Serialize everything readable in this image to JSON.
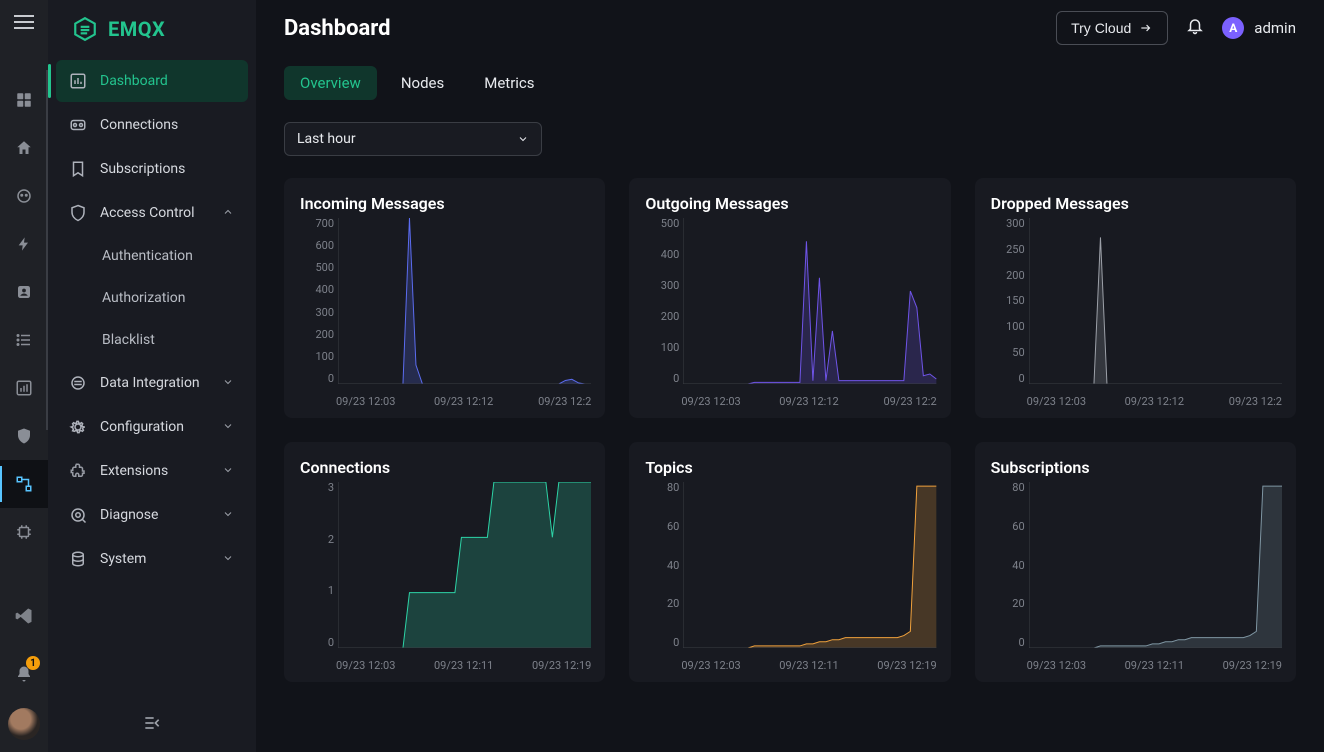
{
  "app": {
    "brand": "EMQX"
  },
  "header": {
    "title": "Dashboard",
    "try_cloud": "Try Cloud",
    "user_name": "admin",
    "user_initial": "A"
  },
  "sidebar": {
    "items": [
      {
        "id": "dashboard",
        "label": "Dashboard",
        "icon": "chart-icon",
        "active": true,
        "expandable": false
      },
      {
        "id": "connections",
        "label": "Connections",
        "icon": "link-icon",
        "active": false,
        "expandable": false
      },
      {
        "id": "subscriptions",
        "label": "Subscriptions",
        "icon": "bookmark-icon",
        "active": false,
        "expandable": false
      },
      {
        "id": "accesscontrol",
        "label": "Access Control",
        "icon": "shield-icon",
        "active": false,
        "expandable": true,
        "expanded": true,
        "children": [
          {
            "id": "authn",
            "label": "Authentication"
          },
          {
            "id": "authz",
            "label": "Authorization"
          },
          {
            "id": "blacklist",
            "label": "Blacklist"
          }
        ]
      },
      {
        "id": "dataint",
        "label": "Data Integration",
        "icon": "integ-icon",
        "active": false,
        "expandable": true
      },
      {
        "id": "config",
        "label": "Configuration",
        "icon": "gear-icon",
        "active": false,
        "expandable": true
      },
      {
        "id": "ext",
        "label": "Extensions",
        "icon": "puzzle-icon",
        "active": false,
        "expandable": true
      },
      {
        "id": "diag",
        "label": "Diagnose",
        "icon": "eye-icon",
        "active": false,
        "expandable": true
      },
      {
        "id": "system",
        "label": "System",
        "icon": "db-icon",
        "active": false,
        "expandable": true
      }
    ]
  },
  "tabs": {
    "items": [
      {
        "id": "overview",
        "label": "Overview",
        "active": true
      },
      {
        "id": "nodes",
        "label": "Nodes",
        "active": false
      },
      {
        "id": "metrics",
        "label": "Metrics",
        "active": false
      }
    ]
  },
  "time_range": {
    "selected": "Last hour"
  },
  "chart_data": [
    {
      "id": "incoming",
      "title": "Incoming Messages",
      "type": "area",
      "color": "#5b6cf0",
      "y_ticks": [
        "700",
        "600",
        "500",
        "400",
        "300",
        "200",
        "100",
        "0"
      ],
      "ylim": [
        0,
        700
      ],
      "x_ticks": [
        "09/23 12:03",
        "09/23 12:12",
        "09/23 12:2"
      ],
      "x": [
        0,
        1,
        2,
        3,
        4,
        5,
        6,
        7,
        8,
        9,
        10,
        11,
        12,
        13,
        14,
        15,
        16,
        17,
        18,
        19,
        20,
        21,
        22,
        23,
        24,
        25,
        26,
        27,
        28,
        29,
        30,
        31,
        32,
        33,
        34,
        35,
        36,
        37,
        38,
        39
      ],
      "values": [
        0,
        0,
        0,
        0,
        0,
        0,
        0,
        0,
        0,
        0,
        0,
        700,
        80,
        0,
        0,
        0,
        0,
        0,
        0,
        0,
        0,
        0,
        0,
        0,
        0,
        0,
        0,
        0,
        0,
        0,
        0,
        0,
        0,
        0,
        0,
        15,
        20,
        5,
        0,
        0
      ]
    },
    {
      "id": "outgoing",
      "title": "Outgoing Messages",
      "type": "area",
      "color": "#6f54e8",
      "y_ticks": [
        "500",
        "400",
        "300",
        "200",
        "100",
        "0"
      ],
      "ylim": [
        0,
        500
      ],
      "x_ticks": [
        "09/23 12:03",
        "09/23 12:12",
        "09/23 12:2"
      ],
      "x": [
        0,
        1,
        2,
        3,
        4,
        5,
        6,
        7,
        8,
        9,
        10,
        11,
        12,
        13,
        14,
        15,
        16,
        17,
        18,
        19,
        20,
        21,
        22,
        23,
        24,
        25,
        26,
        27,
        28,
        29,
        30,
        31,
        32,
        33,
        34,
        35,
        36,
        37,
        38,
        39
      ],
      "values": [
        0,
        0,
        0,
        0,
        0,
        0,
        0,
        0,
        0,
        0,
        0,
        5,
        5,
        5,
        5,
        5,
        5,
        5,
        5,
        430,
        10,
        320,
        10,
        160,
        10,
        10,
        10,
        10,
        10,
        10,
        10,
        10,
        10,
        10,
        10,
        280,
        230,
        25,
        30,
        15
      ]
    },
    {
      "id": "dropped",
      "title": "Dropped Messages",
      "type": "area",
      "color": "#9ca0a8",
      "y_ticks": [
        "300",
        "250",
        "200",
        "150",
        "100",
        "50",
        "0"
      ],
      "ylim": [
        0,
        300
      ],
      "x_ticks": [
        "09/23 12:03",
        "09/23 12:12",
        "09/23 12:2"
      ],
      "x": [
        0,
        1,
        2,
        3,
        4,
        5,
        6,
        7,
        8,
        9,
        10,
        11,
        12,
        13,
        14,
        15,
        16,
        17,
        18,
        19,
        20,
        21,
        22,
        23,
        24,
        25,
        26,
        27,
        28,
        29,
        30,
        31,
        32,
        33,
        34,
        35,
        36,
        37,
        38,
        39
      ],
      "values": [
        0,
        0,
        0,
        0,
        0,
        0,
        0,
        0,
        0,
        0,
        0,
        265,
        0,
        0,
        0,
        0,
        0,
        0,
        0,
        0,
        0,
        0,
        0,
        0,
        0,
        0,
        0,
        0,
        0,
        0,
        0,
        0,
        0,
        0,
        0,
        0,
        0,
        0,
        0,
        0
      ]
    },
    {
      "id": "connections",
      "title": "Connections",
      "type": "area",
      "color": "#2dd4a7",
      "y_ticks": [
        "3",
        "2",
        "1",
        "0"
      ],
      "ylim": [
        0,
        3
      ],
      "x_ticks": [
        "09/23 12:03",
        "09/23 12:11",
        "09/23 12:19"
      ],
      "x": [
        0,
        1,
        2,
        3,
        4,
        5,
        6,
        7,
        8,
        9,
        10,
        11,
        12,
        13,
        14,
        15,
        16,
        17,
        18,
        19,
        20,
        21,
        22,
        23,
        24,
        25,
        26,
        27,
        28,
        29,
        30,
        31,
        32,
        33,
        34,
        35,
        36,
        37,
        38,
        39
      ],
      "values": [
        0,
        0,
        0,
        0,
        0,
        0,
        0,
        0,
        0,
        0,
        0,
        1,
        1,
        1,
        1,
        1,
        1,
        1,
        1,
        2,
        2,
        2,
        2,
        2,
        3,
        3,
        3,
        3,
        3,
        3,
        3,
        3,
        3,
        2,
        3,
        3,
        3,
        3,
        3,
        3
      ]
    },
    {
      "id": "topics",
      "title": "Topics",
      "type": "area",
      "color": "#f0a13c",
      "y_ticks": [
        "80",
        "60",
        "40",
        "20",
        "0"
      ],
      "ylim": [
        0,
        80
      ],
      "x_ticks": [
        "09/23 12:03",
        "09/23 12:11",
        "09/23 12:19"
      ],
      "x": [
        0,
        1,
        2,
        3,
        4,
        5,
        6,
        7,
        8,
        9,
        10,
        11,
        12,
        13,
        14,
        15,
        16,
        17,
        18,
        19,
        20,
        21,
        22,
        23,
        24,
        25,
        26,
        27,
        28,
        29,
        30,
        31,
        32,
        33,
        34,
        35,
        36,
        37,
        38,
        39
      ],
      "values": [
        0,
        0,
        0,
        0,
        0,
        0,
        0,
        0,
        0,
        0,
        0,
        1,
        1,
        1,
        1,
        1,
        1,
        1,
        1,
        2,
        2,
        3,
        3,
        4,
        4,
        5,
        5,
        5,
        5,
        5,
        5,
        5,
        5,
        5,
        6,
        8,
        78,
        78,
        78,
        78
      ]
    },
    {
      "id": "subscriptions",
      "title": "Subscriptions",
      "type": "area",
      "color": "#7f96a3",
      "y_ticks": [
        "80",
        "60",
        "40",
        "20",
        "0"
      ],
      "ylim": [
        0,
        80
      ],
      "x_ticks": [
        "09/23 12:03",
        "09/23 12:11",
        "09/23 12:19"
      ],
      "x": [
        0,
        1,
        2,
        3,
        4,
        5,
        6,
        7,
        8,
        9,
        10,
        11,
        12,
        13,
        14,
        15,
        16,
        17,
        18,
        19,
        20,
        21,
        22,
        23,
        24,
        25,
        26,
        27,
        28,
        29,
        30,
        31,
        32,
        33,
        34,
        35,
        36,
        37,
        38,
        39
      ],
      "values": [
        0,
        0,
        0,
        0,
        0,
        0,
        0,
        0,
        0,
        0,
        0,
        1,
        1,
        1,
        1,
        1,
        1,
        1,
        1,
        2,
        2,
        3,
        3,
        4,
        4,
        5,
        5,
        5,
        5,
        5,
        5,
        5,
        5,
        5,
        6,
        8,
        78,
        78,
        78,
        78
      ]
    }
  ],
  "osbar": {
    "notification_count": "1"
  }
}
